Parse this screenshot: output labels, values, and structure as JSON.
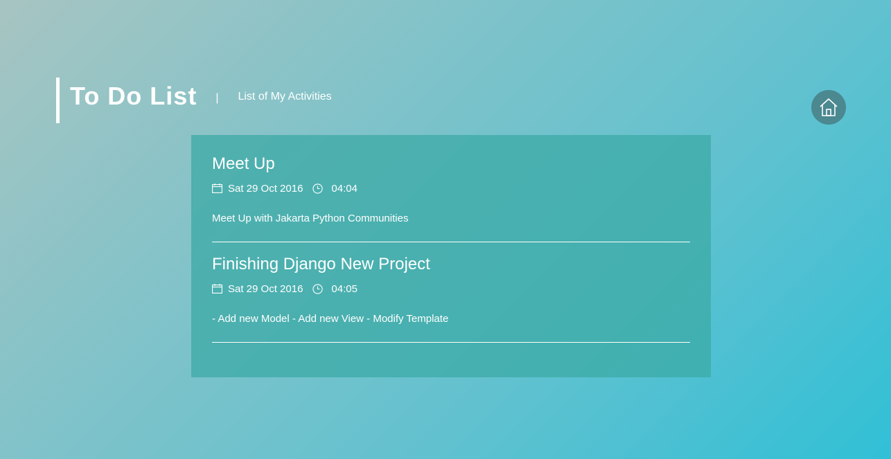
{
  "header": {
    "title": "To Do List",
    "separator": "|",
    "subtitle": "List of My Activities"
  },
  "home_button": {
    "icon": "home-icon"
  },
  "todos": [
    {
      "title": "Meet Up",
      "date": "Sat 29 Oct 2016",
      "time": "04:04",
      "description": "Meet Up with Jakarta Python Communities"
    },
    {
      "title": "Finishing Django New Project",
      "date": "Sat 29 Oct 2016",
      "time": "04:05",
      "description": "- Add new Model - Add new View - Modify Template"
    }
  ],
  "colors": {
    "home_button_bg": "#4b8890",
    "panel_bg": "#4db3b0",
    "text": "#ffffff"
  }
}
